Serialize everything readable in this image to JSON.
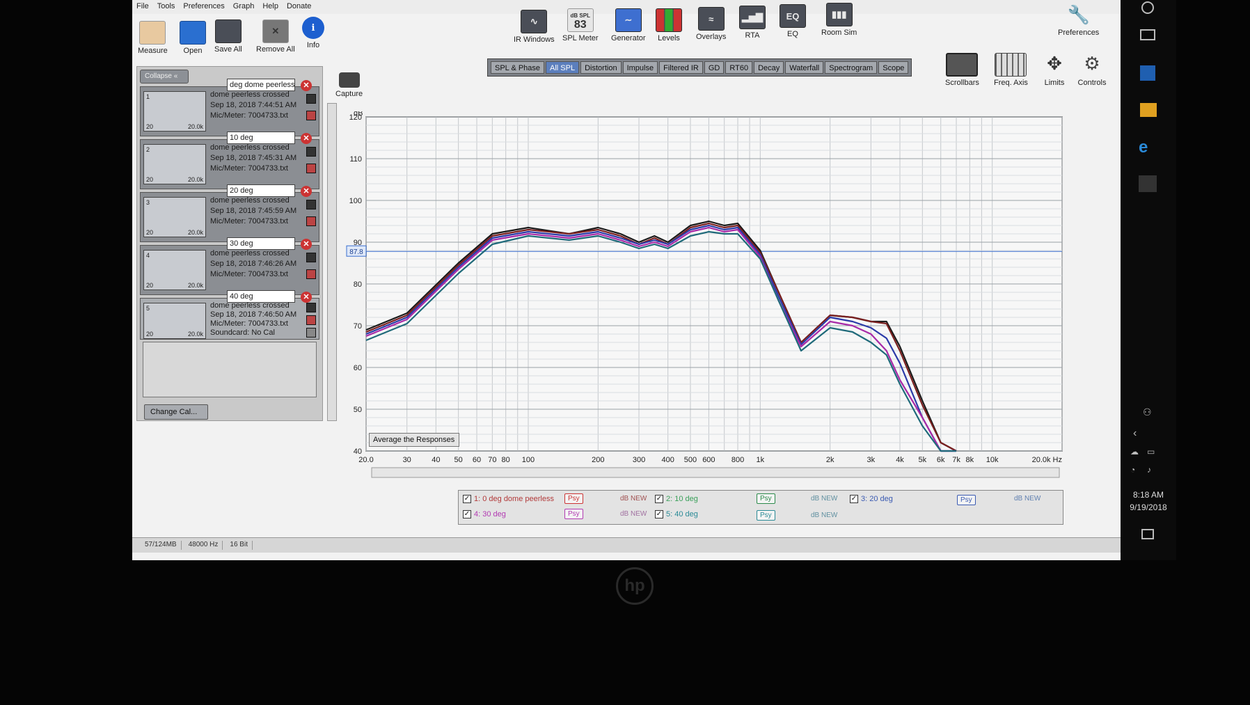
{
  "menu": [
    "File",
    "Tools",
    "Preferences",
    "Graph",
    "Help",
    "Donate"
  ],
  "toolbar_left": [
    {
      "label": "Measure",
      "icon": "measure-icon"
    },
    {
      "label": "Open",
      "icon": "folder-icon"
    },
    {
      "label": "Save All",
      "icon": "save-all-icon"
    },
    {
      "label": "Remove All",
      "icon": "remove-all-icon"
    },
    {
      "label": "Info",
      "icon": "info-icon"
    }
  ],
  "toolbar_center": [
    {
      "label": "IR Windows",
      "icon": "ir-windows-icon"
    },
    {
      "label": "SPL Meter",
      "icon": "spl-meter-icon",
      "badge_top": "dB SPL",
      "badge_value": "83"
    },
    {
      "label": "Generator",
      "icon": "generator-icon"
    },
    {
      "label": "Levels",
      "icon": "levels-icon"
    },
    {
      "label": "Overlays",
      "icon": "overlays-icon"
    },
    {
      "label": "RTA",
      "icon": "rta-icon"
    },
    {
      "label": "EQ",
      "icon": "eq-icon"
    },
    {
      "label": "Room Sim",
      "icon": "room-sim-icon"
    }
  ],
  "preferences_label": "Preferences",
  "right_tools": [
    {
      "label": "Scrollbars",
      "icon": "scrollbars-icon"
    },
    {
      "label": "Freq. Axis",
      "icon": "freq-axis-icon"
    },
    {
      "label": "Limits",
      "icon": "limits-icon"
    },
    {
      "label": "Controls",
      "icon": "controls-gear-icon"
    }
  ],
  "capture_label": "Capture",
  "collapse_label": "Collapse",
  "measurements": [
    {
      "num": "1",
      "name": "deg dome peerless",
      "line1": "dome peerless crossed",
      "line2": "Sep 18, 2018 7:44:51 AM",
      "line3": "Mic/Meter: 7004733.txt",
      "lo": "20",
      "hi": "20.0k"
    },
    {
      "num": "2",
      "name": "10 deg",
      "line1": "dome peerless crossed",
      "line2": "Sep 18, 2018 7:45:31 AM",
      "line3": "Mic/Meter: 7004733.txt",
      "lo": "20",
      "hi": "20.0k"
    },
    {
      "num": "3",
      "name": "20 deg",
      "line1": "dome peerless crossed",
      "line2": "Sep 18, 2018 7:45:59 AM",
      "line3": "Mic/Meter: 7004733.txt",
      "lo": "20",
      "hi": "20.0k"
    },
    {
      "num": "4",
      "name": "30 deg",
      "line1": "dome peerless crossed",
      "line2": "Sep 18, 2018 7:46:26 AM",
      "line3": "Mic/Meter: 7004733.txt",
      "lo": "20",
      "hi": "20.0k"
    },
    {
      "num": "5",
      "name": "40 deg",
      "line1": "dome peerless crossed",
      "line2": "Sep 18, 2018 7:46:50 AM",
      "line3": "Mic/Meter: 7004733.txt",
      "line4": "Soundcard: No Cal",
      "lo": "20",
      "hi": "20.0k"
    }
  ],
  "change_cal_label": "Change Cal...",
  "tabs": [
    "SPL & Phase",
    "All SPL",
    "Distortion",
    "Impulse",
    "Filtered IR",
    "GD",
    "RT60",
    "Decay",
    "Waterfall",
    "Spectrogram",
    "Scope"
  ],
  "active_tab": "All SPL",
  "average_button": "Average the Responses",
  "cursor_value": "87.8",
  "legend": [
    {
      "label": "1: 0 deg dome peerless",
      "color": "#b23a3a"
    },
    {
      "label": "2: 10 deg",
      "color": "#3aa05a"
    },
    {
      "label": "3: 20 deg",
      "color": "#3a5ab2"
    },
    {
      "label": "4: 30 deg",
      "color": "#b23ab2"
    },
    {
      "label": "5: 40 deg",
      "color": "#2a8a96"
    }
  ],
  "psy_label": "Psy",
  "dbnew_label": "dB NEW",
  "status": [
    "57/124MB",
    "48000 Hz",
    "16 Bit"
  ],
  "clock": {
    "time": "8:18 AM",
    "date": "9/19/2018"
  },
  "bezel_logo": "hp",
  "chart_data": {
    "type": "line",
    "ylabel": "dB",
    "xlabel": "Hz",
    "xscale": "log",
    "xlim": [
      20,
      20000
    ],
    "ylim": [
      40,
      120
    ],
    "y_ticks": [
      "120",
      "110",
      "100",
      "90",
      "80",
      "70",
      "60",
      "50",
      "40"
    ],
    "x_ticks": [
      {
        "v": 20,
        "label": "20.0"
      },
      {
        "v": 30,
        "label": "30"
      },
      {
        "v": 40,
        "label": "40"
      },
      {
        "v": 50,
        "label": "50"
      },
      {
        "v": 60,
        "label": "60"
      },
      {
        "v": 70,
        "label": "70"
      },
      {
        "v": 80,
        "label": "80"
      },
      {
        "v": 100,
        "label": "100"
      },
      {
        "v": 200,
        "label": "200"
      },
      {
        "v": 300,
        "label": "300"
      },
      {
        "v": 400,
        "label": "400"
      },
      {
        "v": 500,
        "label": "500"
      },
      {
        "v": 600,
        "label": "600"
      },
      {
        "v": 800,
        "label": "800"
      },
      {
        "v": 1000,
        "label": "1k"
      },
      {
        "v": 2000,
        "label": "2k"
      },
      {
        "v": 3000,
        "label": "3k"
      },
      {
        "v": 4000,
        "label": "4k"
      },
      {
        "v": 5000,
        "label": "5k"
      },
      {
        "v": 6000,
        "label": "6k"
      },
      {
        "v": 7000,
        "label": "7k"
      },
      {
        "v": 8000,
        "label": "8k"
      },
      {
        "v": 10000,
        "label": "10k"
      },
      {
        "v": 20000,
        "label": "20.0k Hz"
      }
    ],
    "series": [
      {
        "name": "1: 0 deg dome peerless",
        "color": "#1a1a1a",
        "x": [
          20,
          30,
          50,
          70,
          100,
          150,
          200,
          250,
          300,
          350,
          400,
          500,
          600,
          700,
          800,
          1000,
          1200,
          1500,
          2000,
          2500,
          3000,
          3500,
          4000,
          5000,
          6000,
          7000
        ],
        "y": [
          69,
          73,
          85,
          92,
          93.5,
          92,
          93.5,
          92,
          90,
          91.5,
          90,
          94,
          95,
          94,
          94.5,
          88,
          78,
          66,
          72.5,
          72,
          71,
          71,
          65,
          52,
          42,
          36
        ]
      },
      {
        "name": "2: 10 deg",
        "color": "#7a1f1f",
        "x": [
          20,
          30,
          50,
          70,
          100,
          150,
          200,
          250,
          300,
          350,
          400,
          500,
          600,
          700,
          800,
          1000,
          1200,
          1500,
          2000,
          2500,
          3000,
          3500,
          4000,
          5000,
          6000,
          7000
        ],
        "y": [
          68.5,
          72.5,
          84.5,
          91.5,
          93,
          92,
          93,
          91.5,
          89.5,
          91,
          89.5,
          93.5,
          94.5,
          93.5,
          94,
          87.5,
          78,
          66,
          72.5,
          72,
          71,
          70.5,
          64,
          51,
          42,
          36
        ]
      },
      {
        "name": "3: 20 deg",
        "color": "#2a3aa8",
        "x": [
          20,
          30,
          50,
          70,
          100,
          150,
          200,
          250,
          300,
          350,
          400,
          500,
          600,
          700,
          800,
          1000,
          1200,
          1500,
          2000,
          2500,
          3000,
          3500,
          4000,
          5000,
          6000,
          7000
        ],
        "y": [
          68,
          72,
          84,
          91,
          92.5,
          91.5,
          92.5,
          91,
          89.5,
          90.5,
          89.5,
          93,
          94,
          93,
          93.5,
          87,
          77,
          65.5,
          72,
          71,
          69.5,
          67,
          61,
          48,
          40,
          36
        ]
      },
      {
        "name": "4: 30 deg",
        "color": "#a82aa8",
        "x": [
          20,
          30,
          50,
          70,
          100,
          150,
          200,
          250,
          300,
          350,
          400,
          500,
          600,
          700,
          800,
          1000,
          1200,
          1500,
          2000,
          2500,
          3000,
          3500,
          4000,
          5000,
          6000,
          7000
        ],
        "y": [
          67.5,
          71.5,
          83.5,
          90.5,
          92,
          91,
          92,
          90.5,
          89,
          90,
          89,
          92.5,
          93.5,
          92.5,
          93,
          86.5,
          76,
          65,
          71,
          70,
          68,
          64,
          57,
          48,
          40,
          36
        ]
      },
      {
        "name": "5: 40 deg",
        "color": "#1f6a7a",
        "x": [
          20,
          30,
          50,
          70,
          100,
          150,
          200,
          250,
          300,
          350,
          400,
          500,
          600,
          700,
          800,
          1000,
          1200,
          1500,
          2000,
          2500,
          3000,
          3500,
          4000,
          5000,
          6000,
          7000
        ],
        "y": [
          66.5,
          70.5,
          82.5,
          89.5,
          91.5,
          90.5,
          91.5,
          90,
          88.5,
          89.5,
          88.5,
          91.5,
          92.5,
          92,
          92,
          86,
          76,
          64,
          69.5,
          68.5,
          66,
          63,
          56,
          46,
          40,
          36
        ]
      }
    ]
  }
}
